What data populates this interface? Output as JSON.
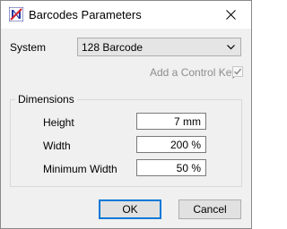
{
  "window": {
    "title": "Barcodes Parameters"
  },
  "system": {
    "label": "System",
    "selected": "128 Barcode"
  },
  "control_key": {
    "label": "Add a Control Key",
    "checked": true,
    "enabled": false
  },
  "dimensions": {
    "group_label": "Dimensions",
    "height": {
      "label": "Height",
      "value": "7 mm"
    },
    "width": {
      "label": "Width",
      "value": "200 %"
    },
    "min_width": {
      "label": "Minimum Width",
      "value": "50 %"
    }
  },
  "buttons": {
    "ok": "OK",
    "cancel": "Cancel"
  },
  "colors": {
    "accent": "#0078d7",
    "icon_red": "#d6232a",
    "icon_blue": "#2b3aa0"
  }
}
